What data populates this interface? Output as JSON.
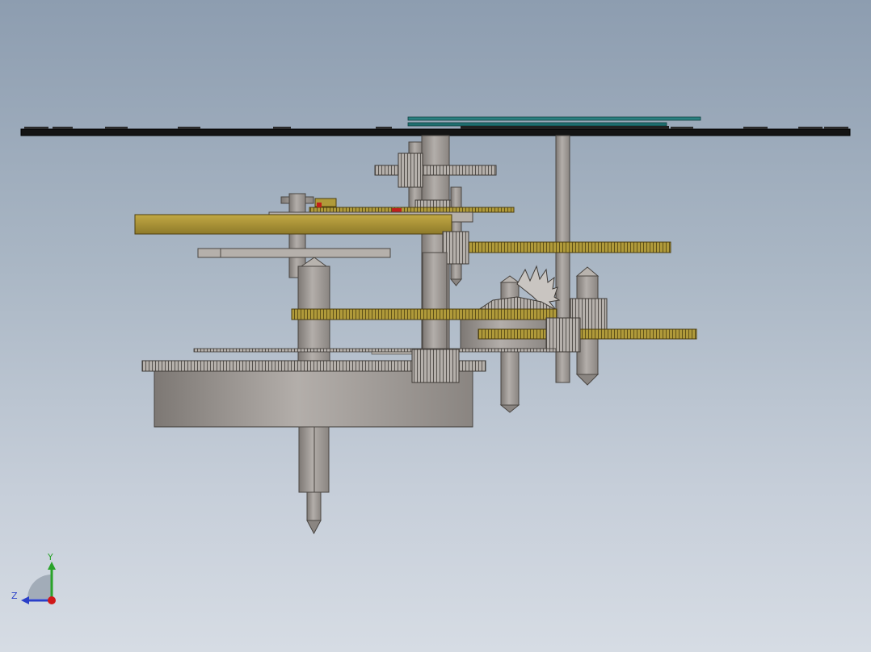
{
  "viewport": {
    "background_top": "#8d9db0",
    "background_bottom": "#d6dce4"
  },
  "colors": {
    "plate": "#1a1a1a",
    "teal_plate": "#2a7f7f",
    "brass": "#b09a3a",
    "brass_dark": "#6e5d1c",
    "steel": "#a8a4a0",
    "steel_dark": "#6f6b67",
    "marker_red": "#c0201a"
  },
  "triad": {
    "y_label": "Y",
    "z_label": "Z",
    "y_axis_color": "#2aa32a",
    "z_axis_color": "#2a3fc8",
    "x_axis_color": "#d01818"
  }
}
